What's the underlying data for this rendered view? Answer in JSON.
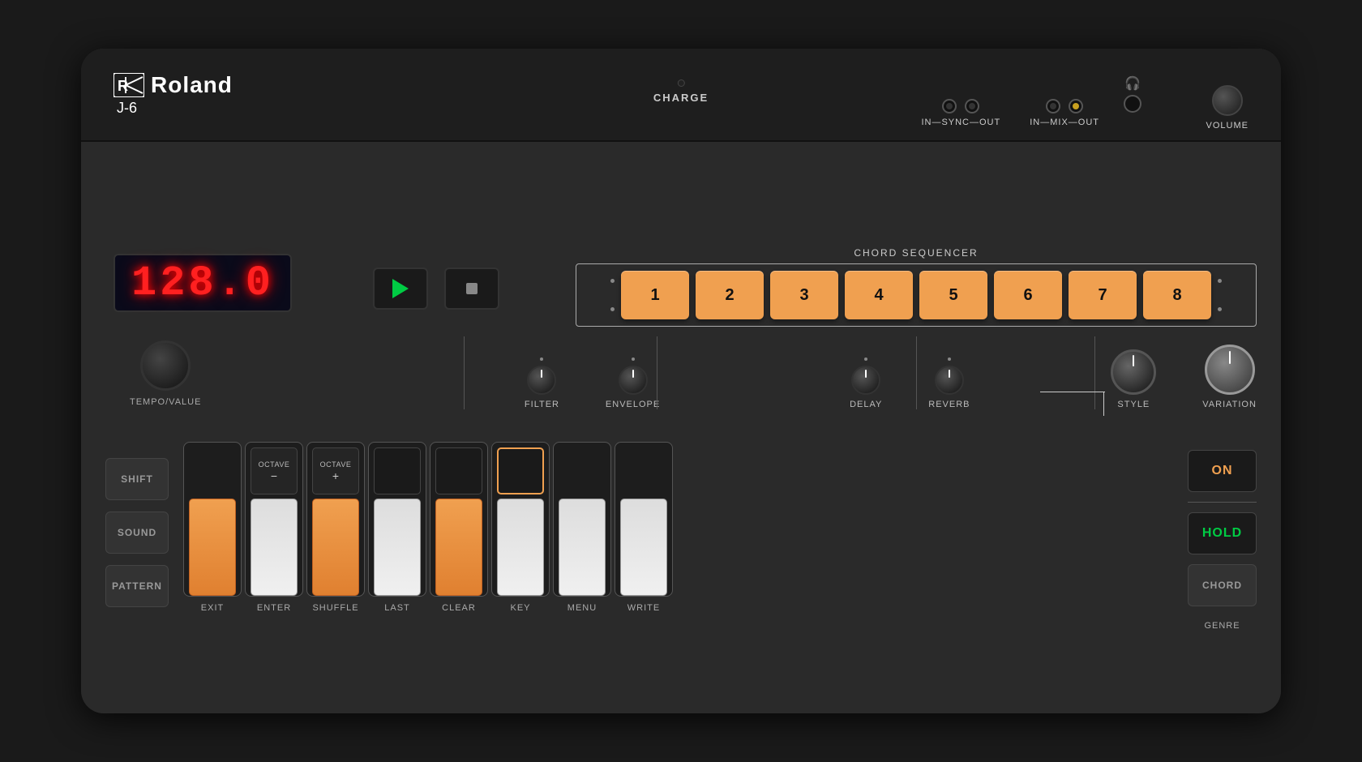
{
  "device": {
    "brand": "Roland",
    "model": "J-6",
    "logo_symbol": "R"
  },
  "top_bar": {
    "charge_label": "CHARGE",
    "sync_label": "IN—SYNC—OUT",
    "mix_label": "IN—MIX—OUT",
    "volume_label": "VOLUME"
  },
  "display": {
    "value": "128.0"
  },
  "transport": {
    "play_label": "PLAY",
    "stop_label": "STOP"
  },
  "chord_sequencer": {
    "title": "CHORD SEQUENCER",
    "buttons": [
      {
        "num": "1"
      },
      {
        "num": "2"
      },
      {
        "num": "3"
      },
      {
        "num": "4"
      },
      {
        "num": "5"
      },
      {
        "num": "6"
      },
      {
        "num": "7"
      },
      {
        "num": "8"
      }
    ]
  },
  "knobs": {
    "filter_label": "FILTER",
    "envelope_label": "ENVELOPE",
    "delay_label": "DELAY",
    "reverb_label": "REVERB",
    "style_label": "STYLE",
    "variation_label": "VARIATION",
    "tempo_label": "TEMPO/VALUE"
  },
  "left_buttons": [
    {
      "label": "SHIFT"
    },
    {
      "label": "SOUND"
    },
    {
      "label": "PATTERN"
    }
  ],
  "keys": [
    {
      "label": "EXIT",
      "white_color": "orange",
      "has_black": false
    },
    {
      "label": "ENTER",
      "white_color": "white",
      "has_black": true,
      "black_type": "octave-minus"
    },
    {
      "label": "SHUFFLE",
      "white_color": "orange",
      "has_black": true,
      "black_type": "octave-plus"
    },
    {
      "label": "LAST",
      "white_color": "white",
      "has_black": true,
      "black_type": "normal"
    },
    {
      "label": "CLEAR",
      "white_color": "orange",
      "has_black": true,
      "black_type": "normal"
    },
    {
      "label": "KEY",
      "white_color": "white",
      "has_black": true,
      "black_type": "active-orange"
    },
    {
      "label": "MENU",
      "white_color": "white",
      "has_black": false
    },
    {
      "label": "WRITE",
      "white_color": "white",
      "has_black": false
    }
  ],
  "right_buttons": {
    "on_label": "ON",
    "hold_label": "HOLD",
    "chord_label": "CHORD",
    "genre_label": "GENRE"
  }
}
